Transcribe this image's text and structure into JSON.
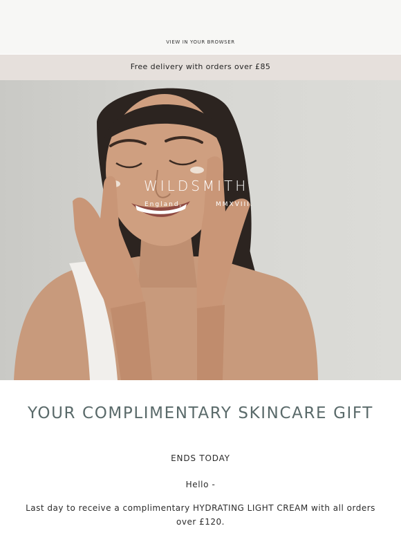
{
  "header": {
    "view_in_browser": "VIEW IN YOUR BROWSER"
  },
  "banner": {
    "text": "Free delivery with orders over £85"
  },
  "hero": {
    "brand_name": "WILDSMITH",
    "brand_place": "England,",
    "brand_year": "MMXVIII."
  },
  "content": {
    "headline": "YOUR COMPLIMENTARY SKINCARE GIFT",
    "ends": "ENDS TODAY",
    "greeting": "Hello -",
    "body": "Last day to receive a complimentary HYDRATING LIGHT CREAM with all orders over £120."
  },
  "colors": {
    "topbar_bg": "#f7f7f5",
    "banner_bg": "#e6e0dc",
    "headline_color": "#5a6a6a"
  }
}
